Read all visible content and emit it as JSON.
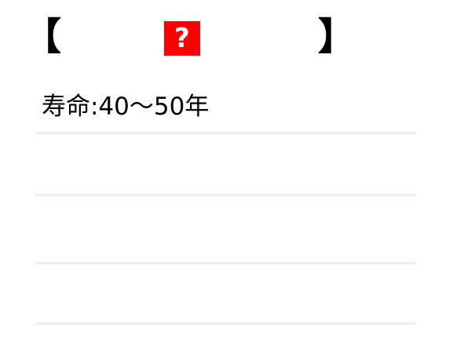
{
  "header": {
    "bracket_left": "【",
    "hidden_label": "?",
    "bracket_right": "】"
  },
  "info": {
    "lifespan": "寿命:40〜50年"
  },
  "colors": {
    "hidden_box": "#ff0000",
    "divider": "#eeeeee"
  }
}
